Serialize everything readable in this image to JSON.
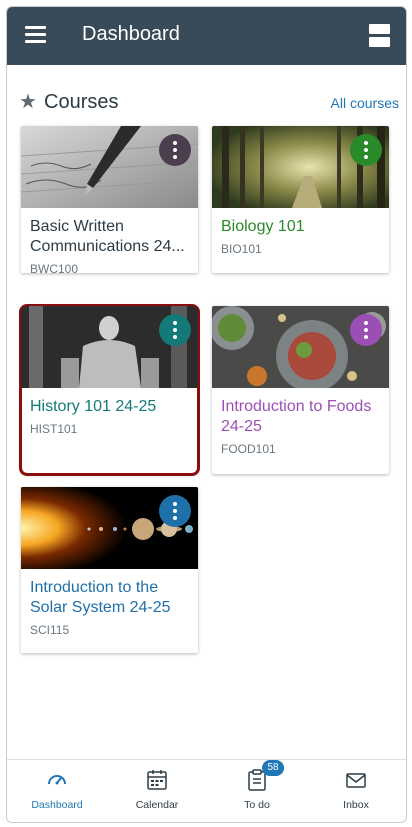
{
  "header": {
    "title": "Dashboard"
  },
  "courses": {
    "heading": "Courses",
    "all_courses_link": "All courses"
  },
  "cards": [
    {
      "title": "Basic Written\nCommunications 24...",
      "code": "BWC100",
      "color": "#4b3f4f"
    },
    {
      "title": "Biology 101",
      "code": "BIO101",
      "color": "#2a8a2a"
    },
    {
      "title": "History 101 24-25",
      "code": "HIST101",
      "color": "#137a78"
    },
    {
      "title": "Introduction to Foods\n24-25",
      "code": "FOOD101",
      "color": "#9b4fb5"
    },
    {
      "title": "Introduction to the\nSolar System  24-25",
      "code": "SCI115",
      "color": "#1f6fa8"
    }
  ],
  "bottom_nav": {
    "dashboard": "Dashboard",
    "calendar": "Calendar",
    "todo": "To do",
    "todo_badge": "58",
    "inbox": "Inbox"
  },
  "colors": {
    "header_bg": "#394b58",
    "link": "#1f77b4",
    "selected_outline": "#8b0e0e"
  }
}
